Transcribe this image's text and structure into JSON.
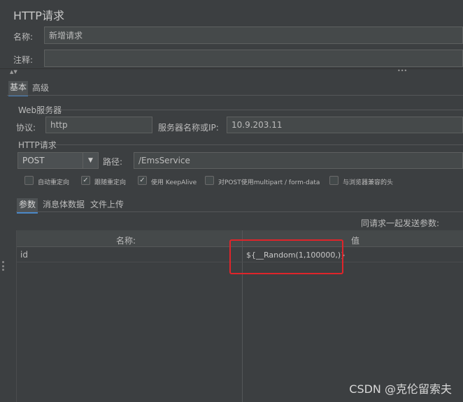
{
  "panel": {
    "title": "HTTP请求"
  },
  "name_field": {
    "label": "名称:",
    "value": "新增请求"
  },
  "comment_field": {
    "label": "注释:",
    "value": ""
  },
  "splitter": {
    "dots": "•••",
    "arrows": "▲▼"
  },
  "main_tabs": [
    {
      "label": "基本"
    },
    {
      "label": "高级"
    }
  ],
  "web_server": {
    "group_label": "Web服务器",
    "protocol_label": "协议:",
    "protocol_value": "http",
    "server_label": "服务器名称或IP:",
    "server_value": "10.9.203.11"
  },
  "http_request": {
    "group_label": "HTTP请求",
    "method": "POST",
    "path_label": "路径:",
    "path_value": "/EmsService"
  },
  "options": [
    {
      "label": "自动重定向",
      "checked": false
    },
    {
      "label": "跟随重定向",
      "checked": true
    },
    {
      "label": "使用 KeepAlive",
      "checked": true
    },
    {
      "label": "对POST使用multipart / form-data",
      "checked": false
    },
    {
      "label": "与浏览器兼容的头",
      "checked": false
    }
  ],
  "param_tabs": [
    {
      "label": "参数"
    },
    {
      "label": "消息体数据"
    },
    {
      "label": "文件上传"
    }
  ],
  "params": {
    "send_label": "同请求一起发送参数:",
    "columns": [
      "名称:",
      "值"
    ],
    "rows": [
      {
        "name": "id",
        "value": "${__Random(1,100000,)}"
      }
    ]
  },
  "watermark": "CSDN @克伦留索夫",
  "colors": {
    "background": "#3c3f41",
    "field": "#45494a",
    "accent": "#4a88c7",
    "highlight": "#e0242a"
  }
}
